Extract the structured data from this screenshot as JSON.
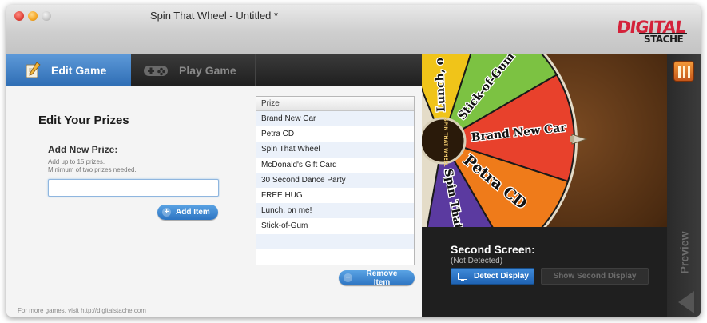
{
  "window": {
    "title": "Spin That Wheel - Untitled *"
  },
  "logo": {
    "top": "DIGITAL",
    "bottom": "STACHE"
  },
  "tabs": [
    {
      "label": "Edit Game",
      "icon": "pencil-paper-icon",
      "active": true
    },
    {
      "label": "Play Game",
      "icon": "gamepad-icon",
      "active": false
    }
  ],
  "editor": {
    "heading": "Edit Your Prizes",
    "add_label": "Add New Prize:",
    "hint_line1": "Add up to 15 prizes.",
    "hint_line2": "Minimum of two prizes needed.",
    "input_value": "",
    "add_button": "Add Item",
    "remove_button": "Remove Item",
    "footer": "For more games, visit http://digitalstache.com"
  },
  "prize_table": {
    "header": "Prize",
    "rows": [
      "Brand New Car",
      "Petra CD",
      "Spin That Wheel",
      "McDonald's Gift Card",
      "30 Second Dance Party",
      "FREE HUG",
      "Lunch, on me!",
      "Stick-of-Gum",
      "",
      ""
    ]
  },
  "wheel": {
    "hub_text": "SPIN THAT WHEEL",
    "segments": [
      {
        "label": "Lunch, on me!",
        "color": "#f0c419",
        "shown": "Lunch, o"
      },
      {
        "label": "Stick-of-Gum",
        "color": "#7cc242",
        "shown": "Stick-of-Gum"
      },
      {
        "label": "Brand New Car",
        "color": "#e8412c",
        "shown": "Brand New Car"
      },
      {
        "label": "Petra CD",
        "color": "#ef7b1a",
        "shown": "Petra CD"
      },
      {
        "label": "Spin That Wheel",
        "color": "#5b3aa0",
        "shown": "Spin That"
      }
    ]
  },
  "second_screen": {
    "title": "Second Screen:",
    "status": "(Not Detected)",
    "detect_button": "Detect Display",
    "show_button": "Show Second Display"
  },
  "side": {
    "preview_label": "Preview"
  },
  "colors": {
    "accent": "#2e6db4",
    "tab_active": "#4a86c8"
  }
}
